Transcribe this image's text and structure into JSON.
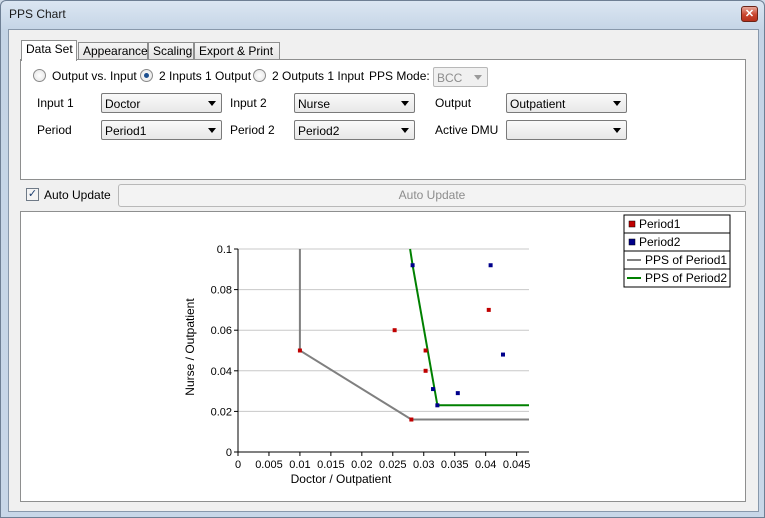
{
  "window": {
    "title": "PPS Chart",
    "close_glyph": "✕"
  },
  "tabs": [
    {
      "label": "Data Set",
      "active": true
    },
    {
      "label": "Appearance",
      "active": false
    },
    {
      "label": "Scaling",
      "active": false
    },
    {
      "label": "Export & Print",
      "active": false
    }
  ],
  "mode": {
    "options": [
      "Output vs. Input",
      "2 Inputs 1 Output",
      "2 Outputs 1 Input"
    ],
    "selected": "2 Inputs 1 Output",
    "pps_mode_label": "PPS Mode:",
    "pps_mode_value": "BCC"
  },
  "fields": {
    "input1_label": "Input 1",
    "input1_value": "Doctor",
    "input2_label": "Input 2",
    "input2_value": "Nurse",
    "output_label": "Output",
    "output_value": "Outpatient",
    "period_label": "Period",
    "period_value": "Period1",
    "period2_label": "Period 2",
    "period2_value": "Period2",
    "active_dmu_label": "Active DMU",
    "active_dmu_value": ""
  },
  "auto_update": {
    "checkbox_label": "Auto Update",
    "checked": true,
    "button_label": "Auto Update"
  },
  "colors": {
    "period1": "#c00000",
    "period2": "#00008b",
    "pps1": "#808080",
    "pps2": "#008000"
  },
  "chart_data": {
    "type": "scatter",
    "xlabel": "Doctor / Outpatient",
    "ylabel": "Nurse / Outpatient",
    "xlim": [
      0,
      0.047
    ],
    "ylim": [
      0,
      0.1
    ],
    "xticks": [
      0,
      0.005,
      0.01,
      0.015,
      0.02,
      0.025,
      0.03,
      0.035,
      0.04,
      0.045
    ],
    "xtick_labels": [
      "0",
      "0.005",
      "0.01",
      "0.015",
      "0.02",
      "0.025",
      "0.03",
      "0.035",
      "0.04",
      "0.045"
    ],
    "yticks": [
      0,
      0.02,
      0.04,
      0.06,
      0.08,
      0.1
    ],
    "ytick_labels": [
      "0",
      "0.02",
      "0.04",
      "0.06",
      "0.08",
      "0.1"
    ],
    "grid": "horizontal",
    "legend_position": "top-right",
    "series": [
      {
        "name": "Period1",
        "kind": "points",
        "color": "#c00000",
        "points": [
          [
            0.01,
            0.05
          ],
          [
            0.0253,
            0.06
          ],
          [
            0.028,
            0.016
          ],
          [
            0.0303,
            0.05
          ],
          [
            0.0303,
            0.04
          ],
          [
            0.0405,
            0.07
          ]
        ]
      },
      {
        "name": "Period2",
        "kind": "points",
        "color": "#00008b",
        "points": [
          [
            0.0282,
            0.092
          ],
          [
            0.0315,
            0.031
          ],
          [
            0.0322,
            0.023
          ],
          [
            0.0355,
            0.029
          ],
          [
            0.0408,
            0.092
          ],
          [
            0.0428,
            0.048
          ]
        ]
      },
      {
        "name": "PPS of Period1",
        "kind": "line",
        "color": "#808080",
        "points": [
          [
            0.01,
            0.1
          ],
          [
            0.01,
            0.05
          ],
          [
            0.028,
            0.016
          ],
          [
            0.047,
            0.016
          ]
        ]
      },
      {
        "name": "PPS of Period2",
        "kind": "line",
        "color": "#008000",
        "points": [
          [
            0.0278,
            0.1
          ],
          [
            0.0282,
            0.092
          ],
          [
            0.0322,
            0.023
          ],
          [
            0.047,
            0.023
          ]
        ]
      }
    ]
  }
}
